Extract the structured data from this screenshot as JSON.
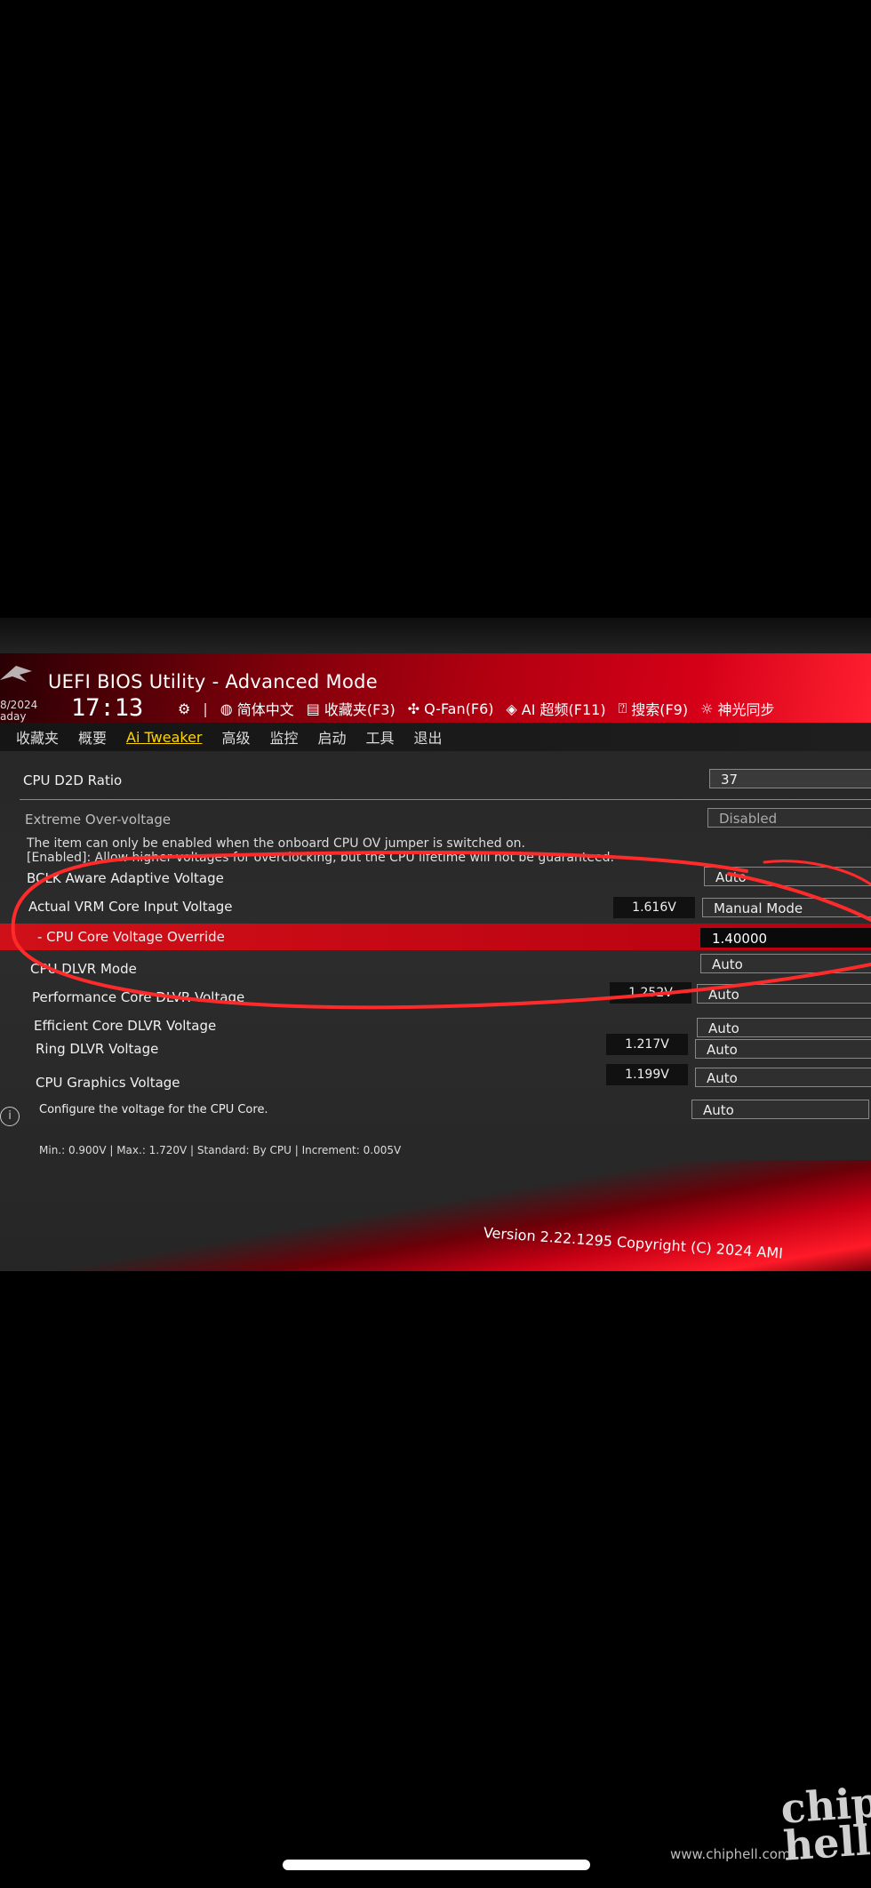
{
  "app_title": "UEFI BIOS Utility - Advanced Mode",
  "date_line1": "8/2024",
  "date_line2": "aday",
  "time": "17:13",
  "toolbar": [
    {
      "icon": "gear-icon",
      "label": ""
    },
    {
      "icon": "globe-icon",
      "label": "简体中文"
    },
    {
      "icon": "bookmark-icon",
      "label": "收藏夹(F3)"
    },
    {
      "icon": "fan-icon",
      "label": "Q-Fan(F6)"
    },
    {
      "icon": "ai-overclock-icon",
      "label": "AI 超频(F11)"
    },
    {
      "icon": "help-icon",
      "label": "搜索(F9)"
    },
    {
      "icon": "light-icon",
      "label": "神光同步"
    }
  ],
  "nav_tabs": [
    "收藏夹",
    "概要",
    "Ai Tweaker",
    "高级",
    "监控",
    "启动",
    "工具",
    "退出"
  ],
  "active_tab": "Ai Tweaker",
  "settings": [
    {
      "label": "CPU D2D Ratio",
      "reading": "",
      "value": "37"
    },
    {
      "label": "Extreme Over-voltage",
      "reading": "",
      "value": "Disabled"
    },
    {
      "label": "BCLK Aware Adaptive Voltage",
      "reading": "",
      "value": "Auto"
    },
    {
      "label": "Actual VRM Core Input Voltage",
      "reading": "1.616V",
      "value": "Manual Mode"
    },
    {
      "label": "- CPU Core Voltage Override",
      "reading": "",
      "value": "1.40000"
    },
    {
      "label": "CPU DLVR Mode",
      "reading": "",
      "value": "Auto"
    },
    {
      "label": "Performance Core DLVR Voltage",
      "reading": "1.252V",
      "value": "Auto"
    },
    {
      "label": "Efficient Core DLVR Voltage",
      "reading": "",
      "value": "Auto"
    },
    {
      "label": "Ring DLVR Voltage",
      "reading": "1.217V",
      "value": "Auto"
    },
    {
      "label": "CPU Graphics Voltage",
      "reading": "1.199V",
      "value": "Auto"
    },
    {
      "label": "",
      "reading": "",
      "value": "Auto"
    }
  ],
  "extreme_note_1": "The item can only be enabled when the onboard CPU OV jumper is switched on.",
  "extreme_note_2": "[Enabled]: Allow higher voltages for overclocking, but the CPU lifetime will not be guaranteed.",
  "help_text": "Configure the voltage for the CPU Core.",
  "range_text": "Min.: 0.900V   |   Max.: 1.720V   |   Standard: By CPU   |   Increment: 0.005V",
  "version": "Version 2.22.1295 Copyright (C) 2024 AMI",
  "watermark_chip": "chip",
  "watermark_hell": "hell",
  "watermark_url": "www.chiphell.com",
  "colors": {
    "accent": "#d50018",
    "active_tab": "#ffd400",
    "annotation": "#ff2a2a"
  }
}
